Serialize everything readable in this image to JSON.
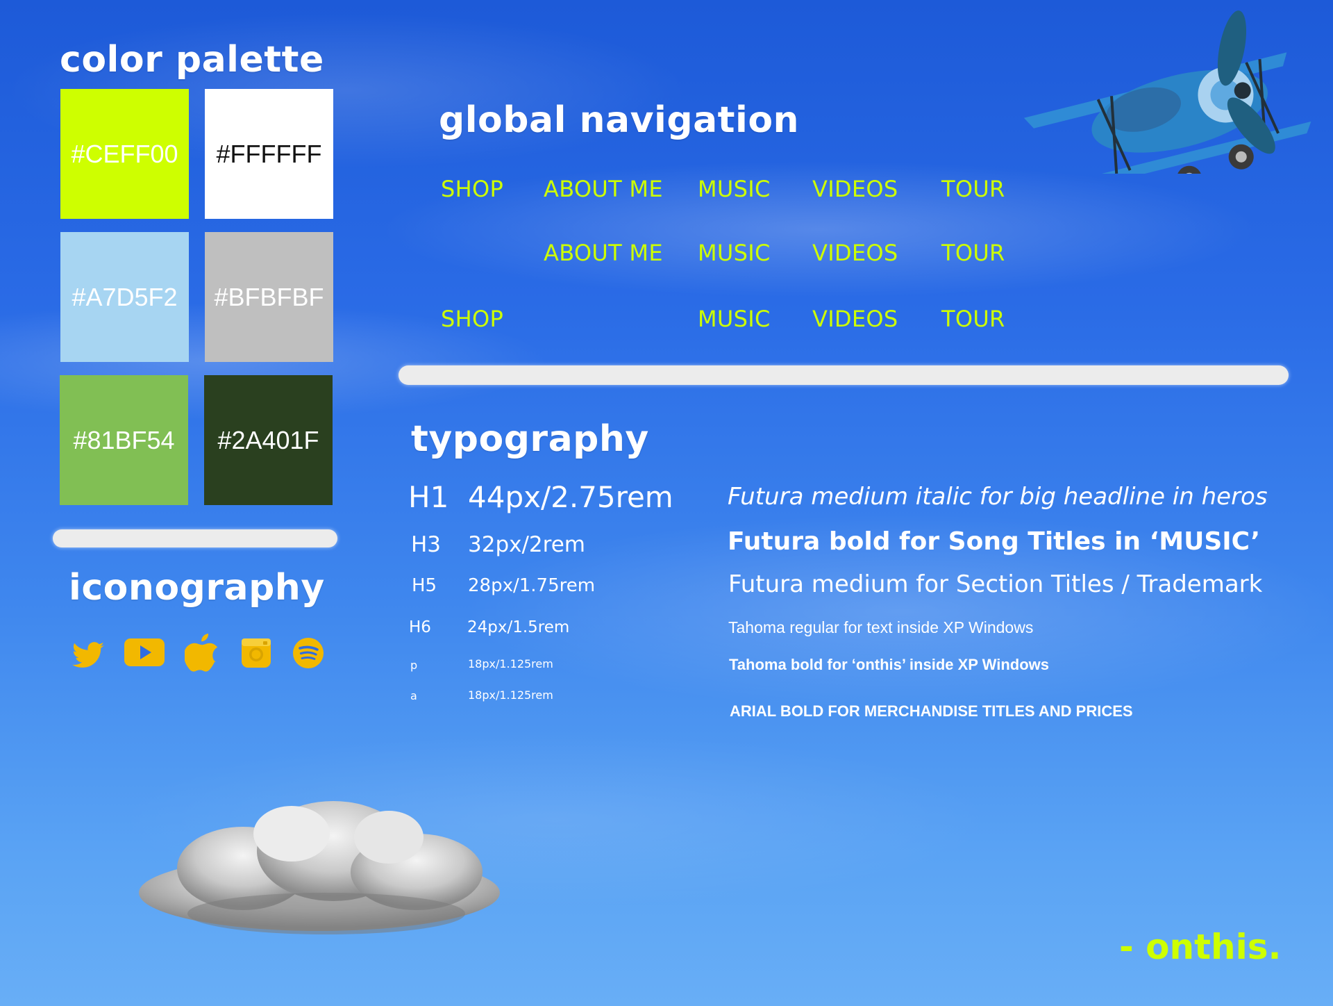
{
  "palette": {
    "title": "color palette",
    "swatches": [
      {
        "label": "#CEFF00",
        "color": "#ceff00",
        "text_color": "#ffffff"
      },
      {
        "label": "#FFFFFF",
        "color": "#ffffff",
        "text_color": "#111111"
      },
      {
        "label": "#A7D5F2",
        "color": "#a7d5f2",
        "text_color": "#ffffff"
      },
      {
        "label": "#BFBFBF",
        "color": "#bfbfbf",
        "text_color": "#ffffff"
      },
      {
        "label": "#81BF54",
        "color": "#81bf54",
        "text_color": "#ffffff"
      },
      {
        "label": "#2A401F",
        "color": "#2a401f",
        "text_color": "#ffffff"
      }
    ]
  },
  "iconography": {
    "title": "iconography",
    "icons": [
      "twitter-icon",
      "youtube-icon",
      "apple-icon",
      "instagram-icon",
      "spotify-icon"
    ],
    "icon_color": "#f2b800"
  },
  "navigation": {
    "title": "global navigation",
    "rows": [
      [
        "SHOP",
        "ABOUT ME",
        "MUSIC",
        "VIDEOS",
        "TOUR"
      ],
      [
        "",
        "ABOUT ME",
        "MUSIC",
        "VIDEOS",
        "TOUR"
      ],
      [
        "SHOP",
        "",
        "MUSIC",
        "VIDEOS",
        "TOUR"
      ]
    ],
    "link_color": "#ceff00"
  },
  "typography": {
    "title": "typography",
    "rows": [
      {
        "tag": "H1",
        "size": "44px/2.75rem",
        "description": "Futura medium italic for big headline in heros"
      },
      {
        "tag": "H3",
        "size": "32px/2rem",
        "description": "Futura bold for Song Titles in ‘MUSIC’"
      },
      {
        "tag": "H5",
        "size": "28px/1.75rem",
        "description": "Futura medium for Section Titles / Trademark"
      },
      {
        "tag": "H6",
        "size": "24px/1.5rem",
        "description": "Tahoma regular for text inside XP Windows"
      },
      {
        "tag": "p",
        "size": "18px/1.125rem",
        "description": "Tahoma bold for ‘onthis’ inside XP Windows"
      },
      {
        "tag": "a",
        "size": "18px/1.125rem",
        "description": "ARIAL BOLD FOR MERCHANDISE TITLES AND PRICES"
      }
    ]
  },
  "signature": "- onthis.",
  "signature_color": "#ceff00"
}
